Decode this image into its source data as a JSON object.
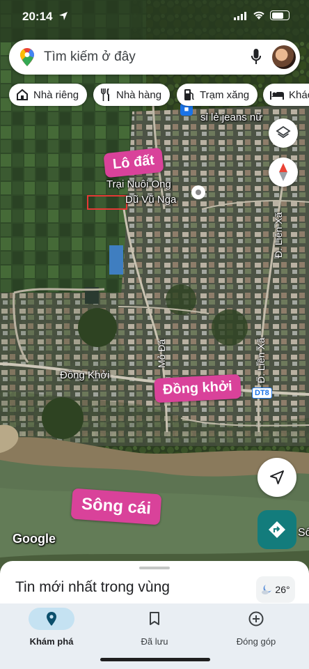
{
  "status_bar": {
    "time": "20:14"
  },
  "search": {
    "placeholder": "Tìm kiếm ở đây"
  },
  "chips": [
    {
      "label": "Nhà riêng",
      "icon": "home-icon"
    },
    {
      "label": "Nhà hàng",
      "icon": "restaurant-icon"
    },
    {
      "label": "Trạm xăng",
      "icon": "gas-station-icon"
    },
    {
      "label": "Khác",
      "icon": "hotel-icon"
    }
  ],
  "map": {
    "labels": {
      "shop": "sỉ lẻ jeans nữ",
      "farm_line1": "Trại Nuôi Ong",
      "farm_line2": "Dũ Vũ Nga",
      "road_dong_khoi": "Đồng Khởi",
      "road_mo_da": "Mỏ Đá",
      "road_lien_xa_1": "Đ. Liên Xã",
      "road_lien_xa_2": "Đ. Liên Xã",
      "road_shield": "DT8",
      "watermark": "Google",
      "edge_text": "Sô"
    },
    "annotations": {
      "lot": "Lô đất",
      "street": "Đồng khởi",
      "river": "Sông cái"
    },
    "annotation_color": "#d9429a"
  },
  "bottom_sheet": {
    "title": "Tin mới nhất trong vùng",
    "temperature": "26°"
  },
  "nav": {
    "explore": "Khám phá",
    "saved": "Đã lưu",
    "contribute": "Đóng góp"
  }
}
